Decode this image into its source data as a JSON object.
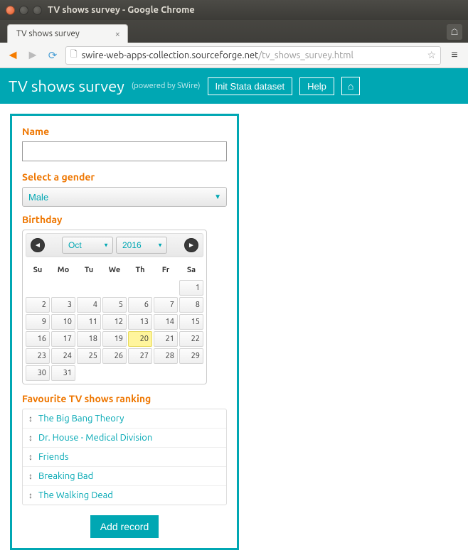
{
  "window": {
    "title": "TV shows survey - Google Chrome"
  },
  "tab": {
    "title": "TV shows survey"
  },
  "address": {
    "host": "swire-web-apps-collection.sourceforge.net",
    "path": "/tv_shows_survey.html"
  },
  "header": {
    "title": "TV shows survey",
    "powered": "(powered by SWire)",
    "init_btn": "Init Stata dataset",
    "help_btn": "Help"
  },
  "form": {
    "name_label": "Name",
    "name_value": "",
    "gender_label": "Select a gender",
    "gender_value": "Male",
    "birthday_label": "Birthday",
    "ranking_label": "Favourite TV shows ranking",
    "add_btn": "Add record"
  },
  "datepicker": {
    "month": "Oct",
    "year": "2016",
    "dow": [
      "Su",
      "Mo",
      "Tu",
      "We",
      "Th",
      "Fr",
      "Sa"
    ],
    "today": 20,
    "weeks": [
      [
        null,
        null,
        null,
        null,
        null,
        null,
        1
      ],
      [
        2,
        3,
        4,
        5,
        6,
        7,
        8
      ],
      [
        9,
        10,
        11,
        12,
        13,
        14,
        15
      ],
      [
        16,
        17,
        18,
        19,
        20,
        21,
        22
      ],
      [
        23,
        24,
        25,
        26,
        27,
        28,
        29
      ],
      [
        30,
        31,
        null,
        null,
        null,
        null,
        null
      ]
    ]
  },
  "ranking": [
    "The Big Bang Theory",
    "Dr. House - Medical Division",
    "Friends",
    "Breaking Bad",
    "The Walking Dead"
  ]
}
